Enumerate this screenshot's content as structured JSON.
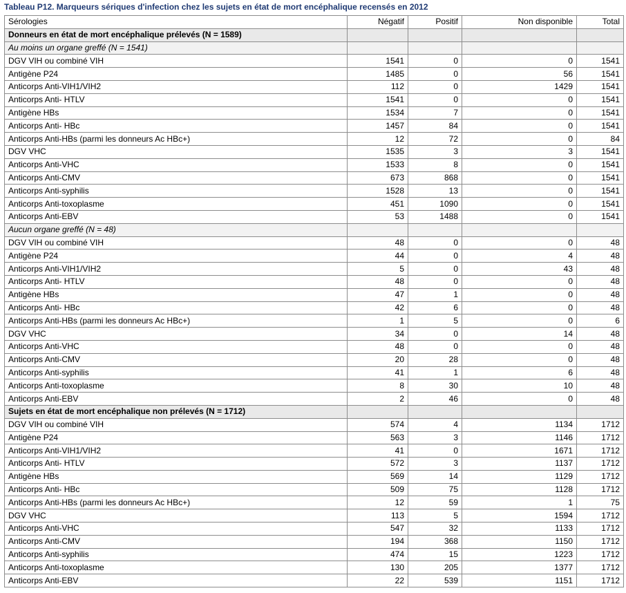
{
  "caption": "Tableau P12. Marqueurs sériques d'infection chez les sujets en état de mort encéphalique recensés en 2012",
  "columns": [
    "Sérologies",
    "Négatif",
    "Positif",
    "Non disponible",
    "Total"
  ],
  "rows": [
    {
      "kind": "section",
      "label": "Donneurs en état de mort encéphalique prélevés (N = 1589)"
    },
    {
      "kind": "subsection",
      "label": "Au moins un organe greffé (N = 1541)"
    },
    {
      "kind": "data",
      "cells": [
        "DGV VIH ou combiné VIH",
        "1541",
        "0",
        "0",
        "1541"
      ]
    },
    {
      "kind": "data",
      "cells": [
        "Antigène P24",
        "1485",
        "0",
        "56",
        "1541"
      ]
    },
    {
      "kind": "data",
      "cells": [
        "Anticorps Anti-VIH1/VIH2",
        "112",
        "0",
        "1429",
        "1541"
      ]
    },
    {
      "kind": "data",
      "cells": [
        "Anticorps Anti- HTLV",
        "1541",
        "0",
        "0",
        "1541"
      ]
    },
    {
      "kind": "data",
      "cells": [
        "Antigène HBs",
        "1534",
        "7",
        "0",
        "1541"
      ]
    },
    {
      "kind": "data",
      "cells": [
        "Anticorps Anti- HBc",
        "1457",
        "84",
        "0",
        "1541"
      ]
    },
    {
      "kind": "data",
      "cells": [
        "Anticorps Anti-HBs (parmi les donneurs Ac HBc+)",
        "12",
        "72",
        "0",
        "84"
      ]
    },
    {
      "kind": "data",
      "cells": [
        "DGV VHC",
        "1535",
        "3",
        "3",
        "1541"
      ]
    },
    {
      "kind": "data",
      "cells": [
        "Anticorps Anti-VHC",
        "1533",
        "8",
        "0",
        "1541"
      ]
    },
    {
      "kind": "data",
      "cells": [
        "Anticorps Anti-CMV",
        "673",
        "868",
        "0",
        "1541"
      ]
    },
    {
      "kind": "data",
      "cells": [
        "Anticorps Anti-syphilis",
        "1528",
        "13",
        "0",
        "1541"
      ]
    },
    {
      "kind": "data",
      "cells": [
        "Anticorps Anti-toxoplasme",
        "451",
        "1090",
        "0",
        "1541"
      ]
    },
    {
      "kind": "data",
      "cells": [
        "Anticorps Anti-EBV",
        "53",
        "1488",
        "0",
        "1541"
      ]
    },
    {
      "kind": "subsection",
      "label": "Aucun organe greffé (N = 48)"
    },
    {
      "kind": "data",
      "cells": [
        "DGV VIH ou combiné VIH",
        "48",
        "0",
        "0",
        "48"
      ]
    },
    {
      "kind": "data",
      "cells": [
        "Antigène P24",
        "44",
        "0",
        "4",
        "48"
      ]
    },
    {
      "kind": "data",
      "cells": [
        "Anticorps Anti-VIH1/VIH2",
        "5",
        "0",
        "43",
        "48"
      ]
    },
    {
      "kind": "data",
      "cells": [
        "Anticorps Anti- HTLV",
        "48",
        "0",
        "0",
        "48"
      ]
    },
    {
      "kind": "data",
      "cells": [
        "Antigène HBs",
        "47",
        "1",
        "0",
        "48"
      ]
    },
    {
      "kind": "data",
      "cells": [
        "Anticorps Anti- HBc",
        "42",
        "6",
        "0",
        "48"
      ]
    },
    {
      "kind": "data",
      "cells": [
        "Anticorps Anti-HBs (parmi les donneurs Ac HBc+)",
        "1",
        "5",
        "0",
        "6"
      ]
    },
    {
      "kind": "data",
      "cells": [
        "DGV VHC",
        "34",
        "0",
        "14",
        "48"
      ]
    },
    {
      "kind": "data",
      "cells": [
        "Anticorps Anti-VHC",
        "48",
        "0",
        "0",
        "48"
      ]
    },
    {
      "kind": "data",
      "cells": [
        "Anticorps Anti-CMV",
        "20",
        "28",
        "0",
        "48"
      ]
    },
    {
      "kind": "data",
      "cells": [
        "Anticorps Anti-syphilis",
        "41",
        "1",
        "6",
        "48"
      ]
    },
    {
      "kind": "data",
      "cells": [
        "Anticorps Anti-toxoplasme",
        "8",
        "30",
        "10",
        "48"
      ]
    },
    {
      "kind": "data",
      "cells": [
        "Anticorps Anti-EBV",
        "2",
        "46",
        "0",
        "48"
      ]
    },
    {
      "kind": "section",
      "label": "Sujets en état de mort encéphalique non prélevés (N = 1712)"
    },
    {
      "kind": "data",
      "cells": [
        "DGV VIH ou combiné VIH",
        "574",
        "4",
        "1134",
        "1712"
      ]
    },
    {
      "kind": "data",
      "cells": [
        "Antigène P24",
        "563",
        "3",
        "1146",
        "1712"
      ]
    },
    {
      "kind": "data",
      "cells": [
        "Anticorps Anti-VIH1/VIH2",
        "41",
        "0",
        "1671",
        "1712"
      ]
    },
    {
      "kind": "data",
      "cells": [
        "Anticorps Anti- HTLV",
        "572",
        "3",
        "1137",
        "1712"
      ]
    },
    {
      "kind": "data",
      "cells": [
        "Antigène HBs",
        "569",
        "14",
        "1129",
        "1712"
      ]
    },
    {
      "kind": "data",
      "cells": [
        "Anticorps Anti- HBc",
        "509",
        "75",
        "1128",
        "1712"
      ]
    },
    {
      "kind": "data",
      "cells": [
        "Anticorps Anti-HBs (parmi les donneurs Ac HBc+)",
        "12",
        "59",
        "1",
        "75"
      ]
    },
    {
      "kind": "data",
      "cells": [
        "DGV VHC",
        "113",
        "5",
        "1594",
        "1712"
      ]
    },
    {
      "kind": "data",
      "cells": [
        "Anticorps Anti-VHC",
        "547",
        "32",
        "1133",
        "1712"
      ]
    },
    {
      "kind": "data",
      "cells": [
        "Anticorps Anti-CMV",
        "194",
        "368",
        "1150",
        "1712"
      ]
    },
    {
      "kind": "data",
      "cells": [
        "Anticorps Anti-syphilis",
        "474",
        "15",
        "1223",
        "1712"
      ]
    },
    {
      "kind": "data",
      "cells": [
        "Anticorps Anti-toxoplasme",
        "130",
        "205",
        "1377",
        "1712"
      ]
    },
    {
      "kind": "data",
      "cells": [
        "Anticorps Anti-EBV",
        "22",
        "539",
        "1151",
        "1712"
      ]
    }
  ]
}
